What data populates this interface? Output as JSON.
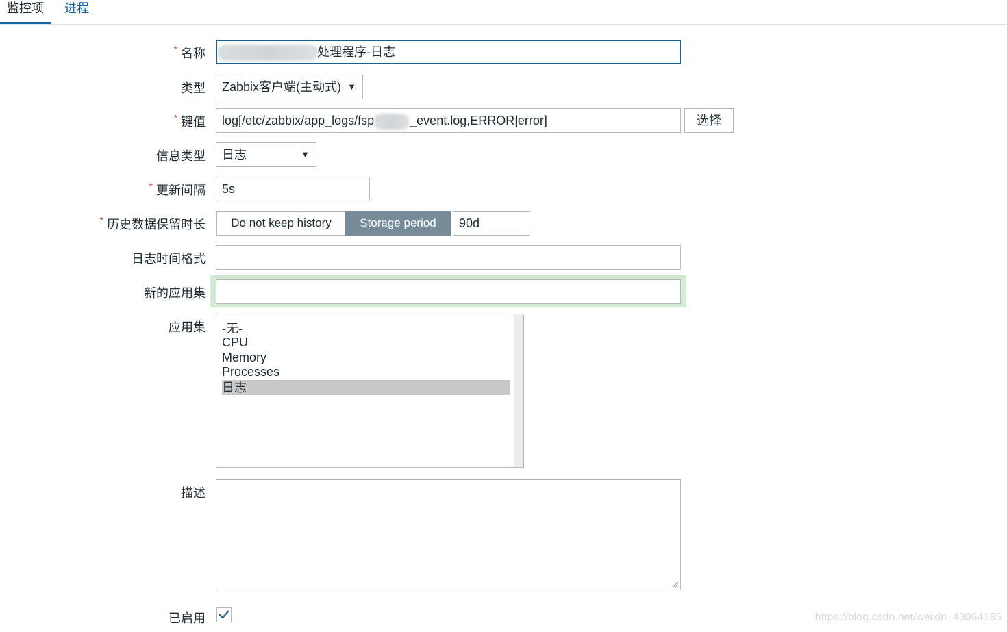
{
  "tabs": [
    {
      "label": "监控项",
      "active": true
    },
    {
      "label": "进程",
      "active": false
    }
  ],
  "form": {
    "name": {
      "label": "名称",
      "required": true,
      "value": "处理程序-日志"
    },
    "type": {
      "label": "类型",
      "value": "Zabbix客户端(主动式)"
    },
    "key": {
      "label": "键值",
      "required": true,
      "value_prefix": "log[/etc/zabbix/app_logs/fsp",
      "value_suffix": "_event.log,ERROR|error]",
      "select_button": "选择"
    },
    "info_type": {
      "label": "信息类型",
      "value": "日志"
    },
    "update_interval": {
      "label": "更新间隔",
      "required": true,
      "value": "5s"
    },
    "history": {
      "label": "历史数据保留时长",
      "required": true,
      "options": [
        "Do not keep history",
        "Storage period"
      ],
      "selected": "Storage period",
      "value": "90d"
    },
    "log_time_format": {
      "label": "日志时间格式",
      "value": ""
    },
    "new_application": {
      "label": "新的应用集",
      "value": ""
    },
    "applications": {
      "label": "应用集",
      "options": [
        "-无-",
        "CPU",
        "Memory",
        "Processes",
        "日志"
      ],
      "selected": "日志"
    },
    "description": {
      "label": "描述",
      "value": ""
    },
    "enabled": {
      "label": "已启用",
      "checked": true
    }
  },
  "watermark": "https://blog.csdn.net/weixin_43064185",
  "colors": {
    "accent": "#0a67a8",
    "segment_active": "#768d99",
    "required": "#e33734",
    "highlight": "#d2e9d2",
    "selected_option": "#c8c8c8"
  }
}
